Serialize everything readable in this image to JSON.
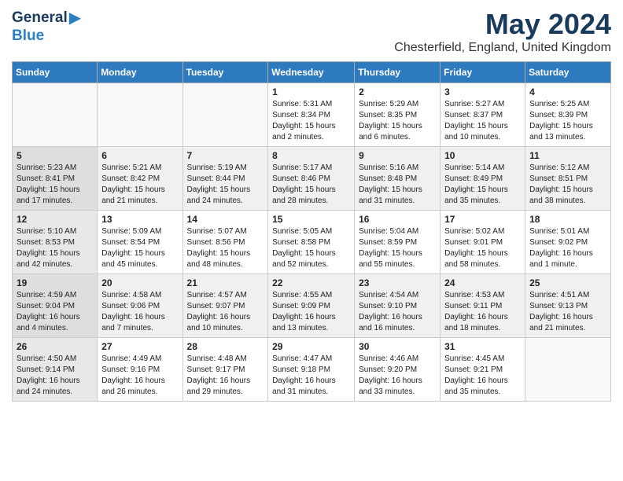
{
  "logo": {
    "general": "General",
    "blue": "Blue"
  },
  "title": "May 2024",
  "location": "Chesterfield, England, United Kingdom",
  "days_of_week": [
    "Sunday",
    "Monday",
    "Tuesday",
    "Wednesday",
    "Thursday",
    "Friday",
    "Saturday"
  ],
  "weeks": [
    [
      {
        "day": "",
        "info": ""
      },
      {
        "day": "",
        "info": ""
      },
      {
        "day": "",
        "info": ""
      },
      {
        "day": "1",
        "info": "Sunrise: 5:31 AM\nSunset: 8:34 PM\nDaylight: 15 hours\nand 2 minutes."
      },
      {
        "day": "2",
        "info": "Sunrise: 5:29 AM\nSunset: 8:35 PM\nDaylight: 15 hours\nand 6 minutes."
      },
      {
        "day": "3",
        "info": "Sunrise: 5:27 AM\nSunset: 8:37 PM\nDaylight: 15 hours\nand 10 minutes."
      },
      {
        "day": "4",
        "info": "Sunrise: 5:25 AM\nSunset: 8:39 PM\nDaylight: 15 hours\nand 13 minutes."
      }
    ],
    [
      {
        "day": "5",
        "info": "Sunrise: 5:23 AM\nSunset: 8:41 PM\nDaylight: 15 hours\nand 17 minutes."
      },
      {
        "day": "6",
        "info": "Sunrise: 5:21 AM\nSunset: 8:42 PM\nDaylight: 15 hours\nand 21 minutes."
      },
      {
        "day": "7",
        "info": "Sunrise: 5:19 AM\nSunset: 8:44 PM\nDaylight: 15 hours\nand 24 minutes."
      },
      {
        "day": "8",
        "info": "Sunrise: 5:17 AM\nSunset: 8:46 PM\nDaylight: 15 hours\nand 28 minutes."
      },
      {
        "day": "9",
        "info": "Sunrise: 5:16 AM\nSunset: 8:48 PM\nDaylight: 15 hours\nand 31 minutes."
      },
      {
        "day": "10",
        "info": "Sunrise: 5:14 AM\nSunset: 8:49 PM\nDaylight: 15 hours\nand 35 minutes."
      },
      {
        "day": "11",
        "info": "Sunrise: 5:12 AM\nSunset: 8:51 PM\nDaylight: 15 hours\nand 38 minutes."
      }
    ],
    [
      {
        "day": "12",
        "info": "Sunrise: 5:10 AM\nSunset: 8:53 PM\nDaylight: 15 hours\nand 42 minutes."
      },
      {
        "day": "13",
        "info": "Sunrise: 5:09 AM\nSunset: 8:54 PM\nDaylight: 15 hours\nand 45 minutes."
      },
      {
        "day": "14",
        "info": "Sunrise: 5:07 AM\nSunset: 8:56 PM\nDaylight: 15 hours\nand 48 minutes."
      },
      {
        "day": "15",
        "info": "Sunrise: 5:05 AM\nSunset: 8:58 PM\nDaylight: 15 hours\nand 52 minutes."
      },
      {
        "day": "16",
        "info": "Sunrise: 5:04 AM\nSunset: 8:59 PM\nDaylight: 15 hours\nand 55 minutes."
      },
      {
        "day": "17",
        "info": "Sunrise: 5:02 AM\nSunset: 9:01 PM\nDaylight: 15 hours\nand 58 minutes."
      },
      {
        "day": "18",
        "info": "Sunrise: 5:01 AM\nSunset: 9:02 PM\nDaylight: 16 hours\nand 1 minute."
      }
    ],
    [
      {
        "day": "19",
        "info": "Sunrise: 4:59 AM\nSunset: 9:04 PM\nDaylight: 16 hours\nand 4 minutes."
      },
      {
        "day": "20",
        "info": "Sunrise: 4:58 AM\nSunset: 9:06 PM\nDaylight: 16 hours\nand 7 minutes."
      },
      {
        "day": "21",
        "info": "Sunrise: 4:57 AM\nSunset: 9:07 PM\nDaylight: 16 hours\nand 10 minutes."
      },
      {
        "day": "22",
        "info": "Sunrise: 4:55 AM\nSunset: 9:09 PM\nDaylight: 16 hours\nand 13 minutes."
      },
      {
        "day": "23",
        "info": "Sunrise: 4:54 AM\nSunset: 9:10 PM\nDaylight: 16 hours\nand 16 minutes."
      },
      {
        "day": "24",
        "info": "Sunrise: 4:53 AM\nSunset: 9:11 PM\nDaylight: 16 hours\nand 18 minutes."
      },
      {
        "day": "25",
        "info": "Sunrise: 4:51 AM\nSunset: 9:13 PM\nDaylight: 16 hours\nand 21 minutes."
      }
    ],
    [
      {
        "day": "26",
        "info": "Sunrise: 4:50 AM\nSunset: 9:14 PM\nDaylight: 16 hours\nand 24 minutes."
      },
      {
        "day": "27",
        "info": "Sunrise: 4:49 AM\nSunset: 9:16 PM\nDaylight: 16 hours\nand 26 minutes."
      },
      {
        "day": "28",
        "info": "Sunrise: 4:48 AM\nSunset: 9:17 PM\nDaylight: 16 hours\nand 29 minutes."
      },
      {
        "day": "29",
        "info": "Sunrise: 4:47 AM\nSunset: 9:18 PM\nDaylight: 16 hours\nand 31 minutes."
      },
      {
        "day": "30",
        "info": "Sunrise: 4:46 AM\nSunset: 9:20 PM\nDaylight: 16 hours\nand 33 minutes."
      },
      {
        "day": "31",
        "info": "Sunrise: 4:45 AM\nSunset: 9:21 PM\nDaylight: 16 hours\nand 35 minutes."
      },
      {
        "day": "",
        "info": ""
      }
    ]
  ]
}
